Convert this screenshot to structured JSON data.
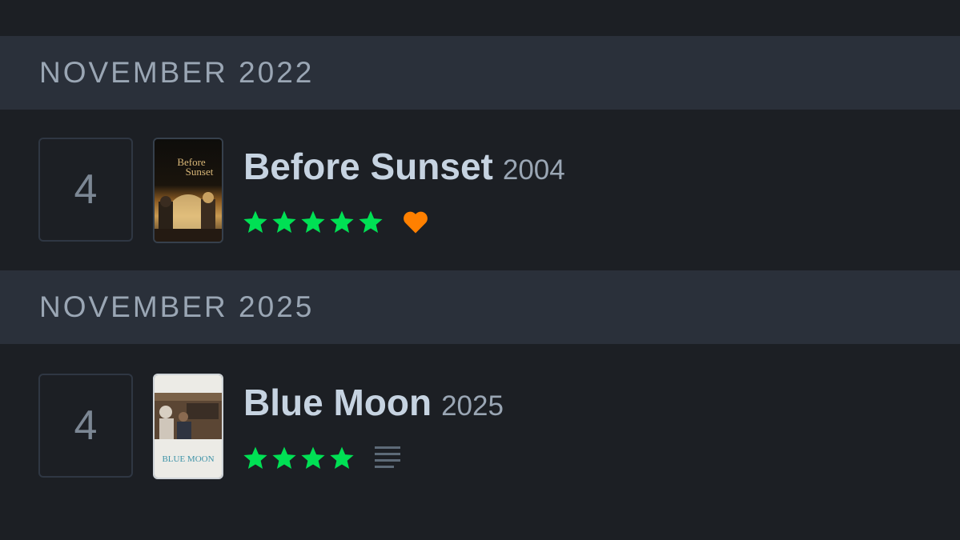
{
  "diary": [
    {
      "month": "NOVEMBER 2022",
      "day": "4",
      "title": "Before Sunset",
      "year": "2004",
      "rating": 5,
      "liked": true,
      "has_review": false,
      "poster_text": [
        "Before",
        "Sunset"
      ]
    },
    {
      "month": "NOVEMBER 2025",
      "day": "4",
      "title": "Blue Moon",
      "year": "2025",
      "rating": 4,
      "liked": false,
      "has_review": true,
      "poster_text": [
        "BLUE MOON"
      ]
    }
  ],
  "colors": {
    "background": "#1c1f24",
    "header_bg": "#2a303a",
    "star": "#00e054",
    "heart": "#ff8000",
    "title": "#c6d3e1",
    "muted": "#9aa6b4",
    "review_icon": "#5d6a78"
  },
  "icons": {
    "star": "star-icon",
    "heart": "heart-icon",
    "review": "review-text-icon"
  }
}
